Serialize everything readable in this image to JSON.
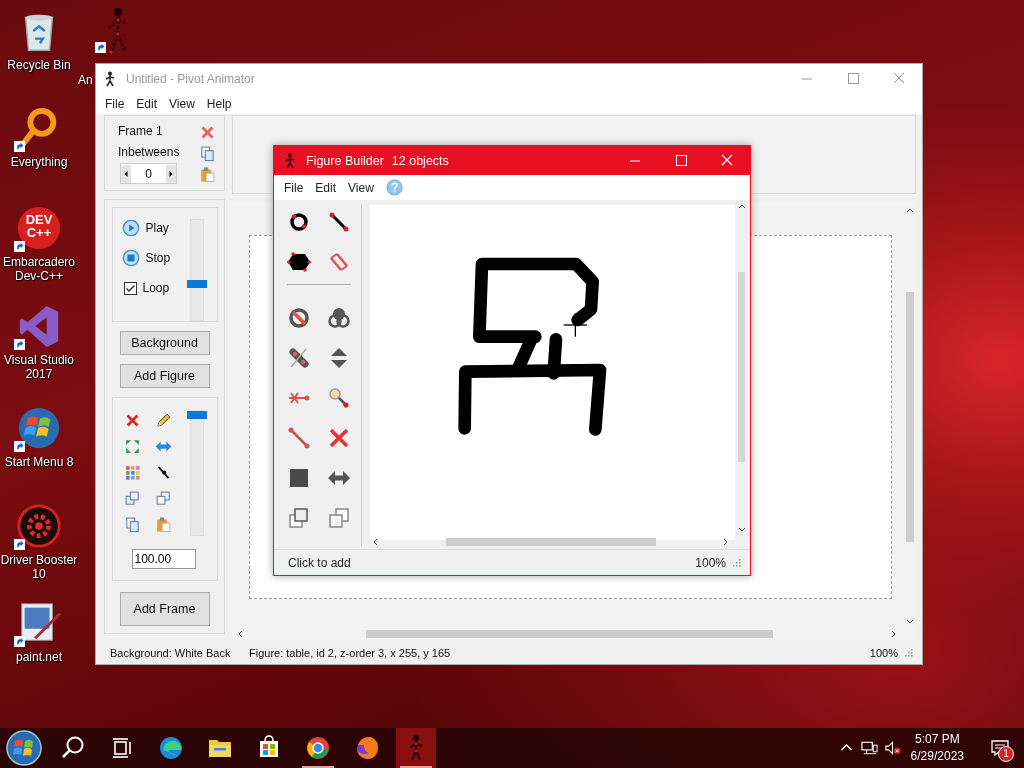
{
  "desktop_icons": [
    {
      "label": "Recycle Bin",
      "shortcut": false
    },
    {
      "label": "Everything",
      "shortcut": true
    },
    {
      "label": "Embarcadero Dev-C++",
      "shortcut": true,
      "logo_text": [
        "DEV",
        "C++"
      ]
    },
    {
      "label": "Visual Studio 2017",
      "shortcut": true
    },
    {
      "label": "Start Menu 8",
      "shortcut": true
    },
    {
      "label": "Driver Booster 10",
      "shortcut": true
    },
    {
      "label": "paint.net",
      "shortcut": true
    },
    {
      "label": "An",
      "shortcut": true
    }
  ],
  "main_window": {
    "title": "Untitled - Pivot Animator",
    "menu": [
      "File",
      "Edit",
      "View",
      "Help"
    ],
    "frame_panel": {
      "frame_label": "Frame 1",
      "inbetweens_label": "Inbetweens",
      "inbetweens_value": "0"
    },
    "playback": {
      "play": "Play",
      "stop": "Stop",
      "loop": {
        "label": "Loop",
        "checked": true
      },
      "speed": {
        "level": 0.35
      }
    },
    "buttons": [
      "Background",
      "Add Figure"
    ],
    "figure_tools": {
      "scale": {
        "level": 1.0
      },
      "value": "100.00"
    },
    "add_frame": "Add Frame",
    "status_bar": [
      "Background: White Back",
      "Figure: table, id 2, z-order 3, x 255, y 165",
      "100%"
    ]
  },
  "figure_builder": {
    "title": "Figure Builder",
    "subtitle": "12 objects",
    "menu": [
      "File",
      "Edit",
      "View"
    ],
    "status": "Click to add",
    "zoom": "100%"
  },
  "taskbar": {
    "time": "5:07 PM",
    "date": "6/29/2023",
    "notifications": "1"
  }
}
